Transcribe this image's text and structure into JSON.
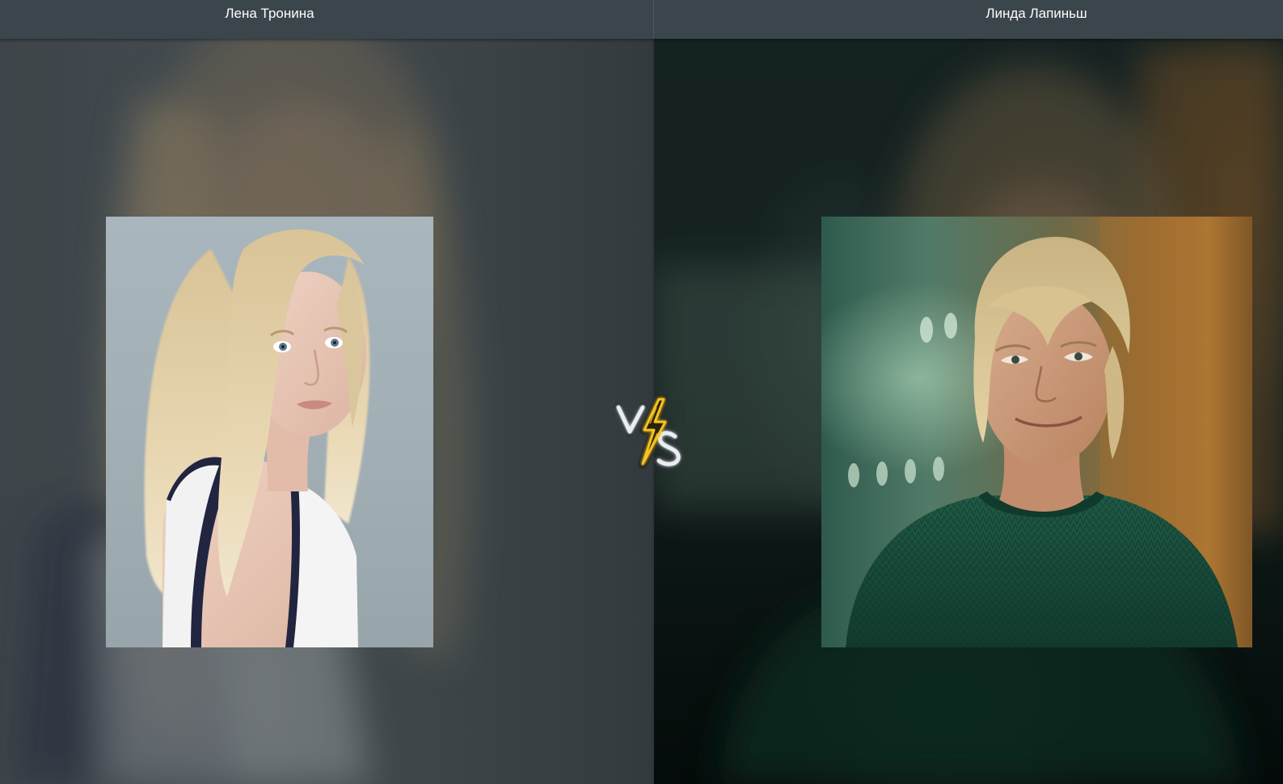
{
  "contestants": {
    "left": {
      "name": "Лена Тронина",
      "photo_icon": "portrait-photo"
    },
    "right": {
      "name": "Линда Лапиньш",
      "photo_icon": "portrait-photo"
    }
  },
  "versus": {
    "icon": "versus-lightning-icon",
    "letter_v": "V",
    "letter_s": "S"
  },
  "colors": {
    "topbar": "#3b454c",
    "accent_lightning": "#f6c21c",
    "text": "#ffffff"
  }
}
